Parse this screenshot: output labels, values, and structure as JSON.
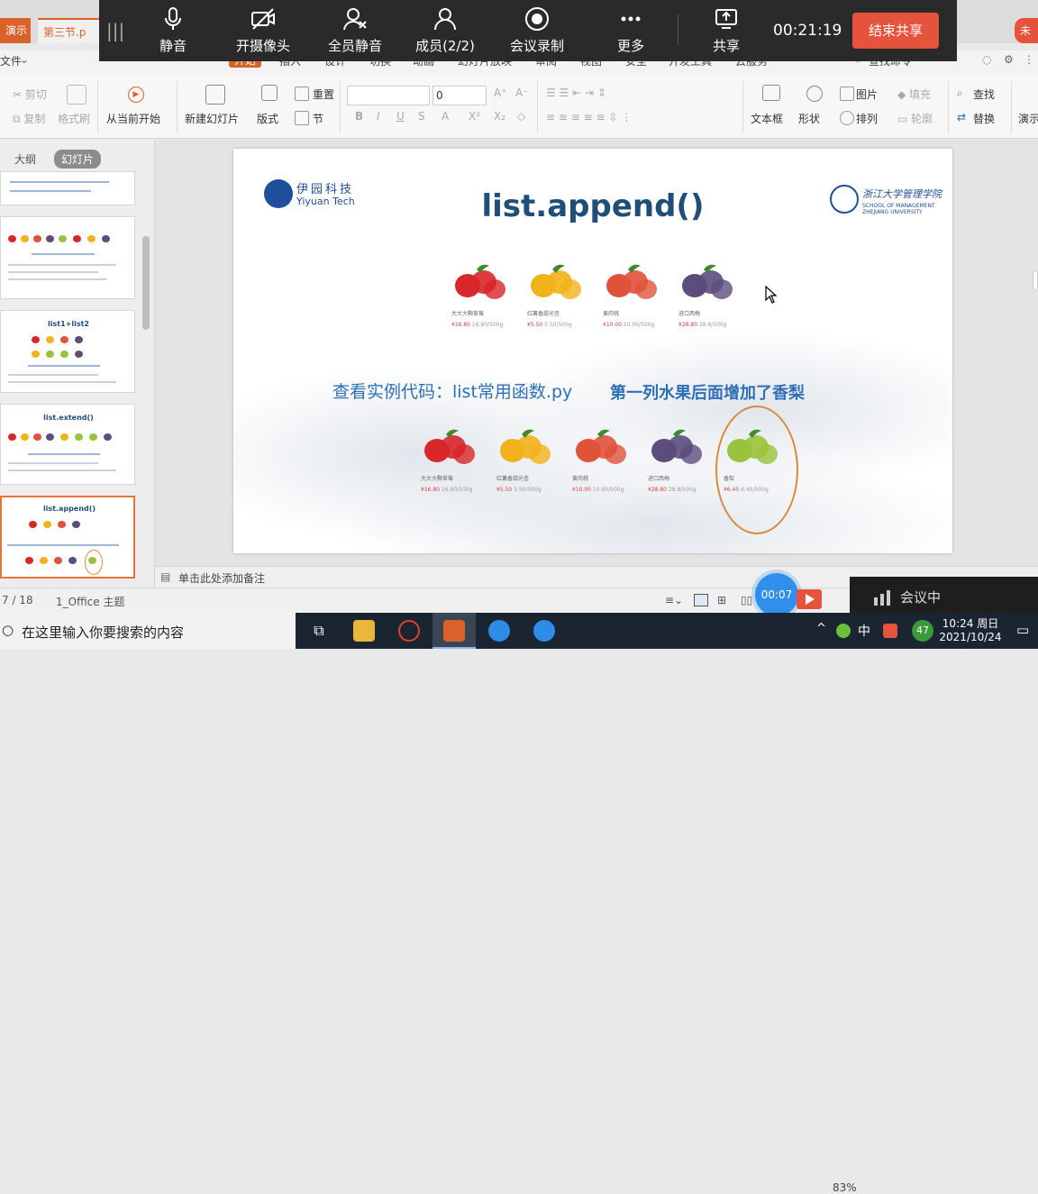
{
  "tabstrip": {
    "tab_yanshi": "演示",
    "tab_file": "第三节.p",
    "tab_unlogged": "未"
  },
  "meeting": {
    "buttons": [
      {
        "label": "静音",
        "icon": "microphone-icon"
      },
      {
        "label": "开摄像头",
        "icon": "camera-off-icon"
      },
      {
        "label": "全员静音",
        "icon": "mute-all-icon"
      },
      {
        "label": "成员(2/2)",
        "icon": "members-icon"
      },
      {
        "label": "会议录制",
        "icon": "record-icon"
      },
      {
        "label": "更多",
        "icon": "more-icon"
      },
      {
        "label": "共享",
        "icon": "share-icon"
      }
    ],
    "timer": "00:21:19",
    "end_label": "结束共享"
  },
  "menu": {
    "file": "文件",
    "items": [
      "开始",
      "插入",
      "设计",
      "切换",
      "动画",
      "幻灯片放映",
      "审阅",
      "视图",
      "安全",
      "开发工具",
      "云服务"
    ],
    "search": "查找命令"
  },
  "ribbon": {
    "cut": "剪切",
    "paste": "粘贴",
    "copy": "复制",
    "format_painter": "格式刷",
    "play_from_current": "从当前开始",
    "new_slide": "新建幻灯片",
    "layout": "版式",
    "reset": "重置",
    "section": "节",
    "font_size": "0",
    "textbox": "文本框",
    "shape": "形状",
    "picture": "图片",
    "arrange": "排列",
    "fill": "填充",
    "outline": "轮廓",
    "find": "查找",
    "replace": "替换",
    "demo": "演示"
  },
  "left_panel": {
    "tab_outline": "大纲",
    "tab_slides": "幻灯片",
    "thumbs": [
      {
        "title": ""
      },
      {
        "title": ""
      },
      {
        "title": "list1+list2"
      },
      {
        "title": "list.extend()"
      },
      {
        "title": "list.append()"
      }
    ]
  },
  "slide": {
    "title": "list.append()",
    "logo_left_cn": "伊园科技",
    "logo_left_en": "Yiyuan Tech",
    "logo_right_cn": "浙江大学管理学院",
    "logo_right_en1": "SCHOOL OF MANAGEMENT",
    "logo_right_en2": "ZHEJIANG UNIVERSITY",
    "row1": [
      {
        "name": "大大大颗草莓",
        "price": "¥16.80",
        "unit": "16.80/500g",
        "color": "#d8262b"
      },
      {
        "name": "红薯香甜光杏",
        "price": "¥5.50",
        "unit": "5.50/500g",
        "color": "#f2b21b"
      },
      {
        "name": "黄肉桃",
        "price": "¥10.00",
        "unit": "10.00/500g",
        "color": "#e0523a"
      },
      {
        "name": "进口西梅",
        "price": "¥28.80",
        "unit": "28.8/500g",
        "color": "#5c4d7d"
      }
    ],
    "row2": [
      {
        "name": "大大大颗草莓",
        "price": "¥16.80",
        "unit": "16.80/500g",
        "color": "#d8262b"
      },
      {
        "name": "红薯香甜光杏",
        "price": "¥5.50",
        "unit": "5.50/500g",
        "color": "#f2b21b"
      },
      {
        "name": "黄肉桃",
        "price": "¥10.00",
        "unit": "10.00/500g",
        "color": "#e0523a"
      },
      {
        "name": "进口西梅",
        "price": "¥28.80",
        "unit": "28.8/500g",
        "color": "#5c4d7d"
      },
      {
        "name": "香梨",
        "price": "¥6.45",
        "unit": "6.45/500g",
        "color": "#9bc23c"
      }
    ],
    "caption_left": "查看实例代码：list常用函数.py",
    "caption_right": "第一列水果后面增加了香梨"
  },
  "notes": {
    "placeholder": "单击此处添加备注"
  },
  "status": {
    "page": "7 / 18",
    "theme": "1_Office 主题",
    "record_time": "00:07",
    "zoom": "83%",
    "meeting_status": "会议中"
  },
  "taskbar": {
    "search": "在这里输入你要搜索的内容",
    "ime": "中",
    "badge": "47",
    "time": "10:24 周日",
    "date": "2021/10/24"
  },
  "colors": {
    "accent": "#d9622b",
    "meeting_bg": "#2a2a2a",
    "end_btn": "#e5533d",
    "title_blue": "#1f4e79",
    "caption_blue": "#2e6fb5",
    "ellipse": "#d98b3b"
  }
}
